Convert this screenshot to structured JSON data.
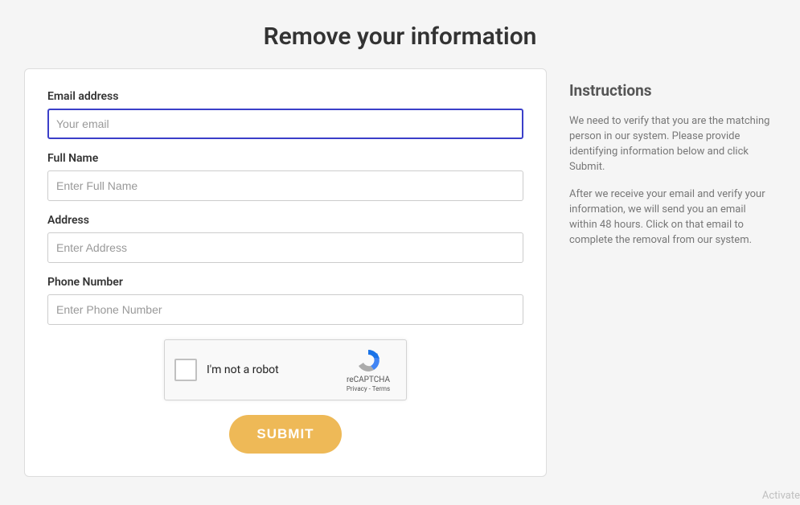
{
  "page": {
    "title": "Remove your information"
  },
  "form": {
    "email": {
      "label": "Email address",
      "placeholder": "Your email",
      "value": ""
    },
    "fullname": {
      "label": "Full Name",
      "placeholder": "Enter Full Name",
      "value": ""
    },
    "address": {
      "label": "Address",
      "placeholder": "Enter Address",
      "value": ""
    },
    "phone": {
      "label": "Phone Number",
      "placeholder": "Enter Phone Number",
      "value": ""
    },
    "captcha": {
      "label": "I'm not a robot",
      "brand": "reCAPTCHA",
      "privacy": "Privacy",
      "terms": "Terms"
    },
    "submit_label": "SUBMIT"
  },
  "sidebar": {
    "title": "Instructions",
    "p1": "We need to verify that you are the matching person in our system. Please provide identifying information below and click Submit.",
    "p2": "After we receive your email and verify your information, we will send you an email within 48 hours. Click on that email to complete the removal from our system."
  },
  "watermark": "Activate"
}
